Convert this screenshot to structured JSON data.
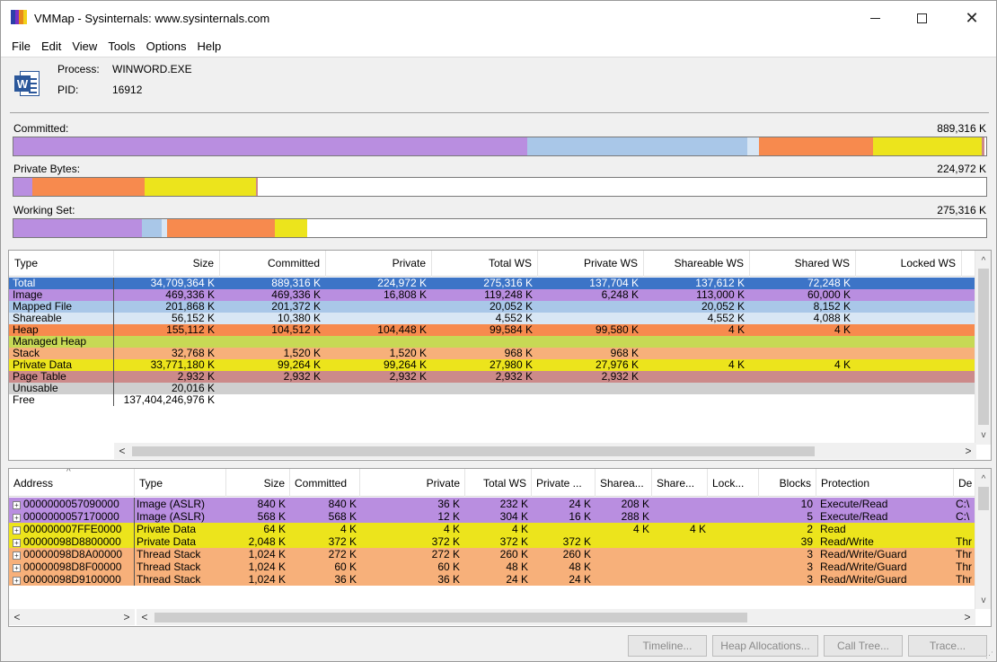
{
  "window": {
    "title": "VMMap - Sysinternals: www.sysinternals.com",
    "icon": "vmmap-app-icon",
    "controls": {
      "minimize": "minimize-icon",
      "maximize": "maximize-icon",
      "close": "close-icon"
    }
  },
  "menu": [
    "File",
    "Edit",
    "View",
    "Tools",
    "Options",
    "Help"
  ],
  "process": {
    "icon": "word-icon",
    "process_label": "Process:",
    "process_value": "WINWORD.EXE",
    "pid_label": "PID:",
    "pid_value": "16912"
  },
  "colors": {
    "image": "#b98ee0",
    "mapped_file": "#a9c7e8",
    "shareable": "#d8e6f4",
    "heap": "#f78a4e",
    "managed_heap": "#c7d955",
    "stack": "#f7b07a",
    "private_data": "#ece41c",
    "page_table": "#cc8a8a",
    "unusable": "#cfcfcf",
    "total_selected": "#3c74c7"
  },
  "bars": {
    "committed": {
      "label": "Committed:",
      "value": "889,316 K",
      "segments": [
        {
          "type": "image",
          "fraction": 0.528
        },
        {
          "type": "mapped_file",
          "fraction": 0.226
        },
        {
          "type": "shareable",
          "fraction": 0.012
        },
        {
          "type": "heap",
          "fraction": 0.118
        },
        {
          "type": "private_data",
          "fraction": 0.111
        },
        {
          "type": "page_table",
          "fraction": 0.003
        }
      ]
    },
    "private_bytes": {
      "label": "Private Bytes:",
      "value": "224,972 K",
      "segments": [
        {
          "type": "image",
          "fraction": 0.019
        },
        {
          "type": "heap",
          "fraction": 0.116
        },
        {
          "type": "private_data",
          "fraction": 0.114
        },
        {
          "type": "page_table",
          "fraction": 0.002
        }
      ]
    },
    "working_set": {
      "label": "Working Set:",
      "value": "275,316 K",
      "segments": [
        {
          "type": "image",
          "fraction": 0.132
        },
        {
          "type": "mapped_file",
          "fraction": 0.02
        },
        {
          "type": "shareable",
          "fraction": 0.006
        },
        {
          "type": "heap",
          "fraction": 0.111
        },
        {
          "type": "private_data",
          "fraction": 0.033
        }
      ]
    }
  },
  "summary": {
    "columns": [
      "Type",
      "Size",
      "Committed",
      "Private",
      "Total WS",
      "Private WS",
      "Shareable WS",
      "Shared WS",
      "Locked WS"
    ],
    "rows": [
      {
        "color": "total_selected",
        "cells": [
          "Total",
          "34,709,364 K",
          "889,316 K",
          "224,972 K",
          "275,316 K",
          "137,704 K",
          "137,612 K",
          "72,248 K",
          ""
        ]
      },
      {
        "color": "image",
        "cells": [
          "Image",
          "469,336 K",
          "469,336 K",
          "16,808 K",
          "119,248 K",
          "6,248 K",
          "113,000 K",
          "60,000 K",
          ""
        ]
      },
      {
        "color": "mapped_file",
        "cells": [
          "Mapped File",
          "201,868 K",
          "201,372 K",
          "",
          "20,052 K",
          "",
          "20,052 K",
          "8,152 K",
          ""
        ]
      },
      {
        "color": "shareable",
        "cells": [
          "Shareable",
          "56,152 K",
          "10,380 K",
          "",
          "4,552 K",
          "",
          "4,552 K",
          "4,088 K",
          ""
        ]
      },
      {
        "color": "heap",
        "cells": [
          "Heap",
          "155,112 K",
          "104,512 K",
          "104,448 K",
          "99,584 K",
          "99,580 K",
          "4 K",
          "4 K",
          ""
        ]
      },
      {
        "color": "managed_heap",
        "cells": [
          "Managed Heap",
          "",
          "",
          "",
          "",
          "",
          "",
          "",
          ""
        ]
      },
      {
        "color": "stack",
        "cells": [
          "Stack",
          "32,768 K",
          "1,520 K",
          "1,520 K",
          "968 K",
          "968 K",
          "",
          "",
          ""
        ]
      },
      {
        "color": "private_data",
        "cells": [
          "Private Data",
          "33,771,180 K",
          "99,264 K",
          "99,264 K",
          "27,980 K",
          "27,976 K",
          "4 K",
          "4 K",
          ""
        ]
      },
      {
        "color": "page_table",
        "cells": [
          "Page Table",
          "2,932 K",
          "2,932 K",
          "2,932 K",
          "2,932 K",
          "2,932 K",
          "",
          "",
          ""
        ]
      },
      {
        "color": "unusable",
        "cells": [
          "Unusable",
          "20,016 K",
          "",
          "",
          "",
          "",
          "",
          "",
          ""
        ]
      },
      {
        "color": "free",
        "cells": [
          "Free",
          "137,404,246,976 K",
          "",
          "",
          "",
          "",
          "",
          "",
          ""
        ]
      }
    ]
  },
  "details": {
    "columns": [
      "Address",
      "Type",
      "Size",
      "Committed",
      "Private",
      "Total WS",
      "Private ...",
      "Sharea...",
      "Share...",
      "Lock...",
      "Blocks",
      "Protection",
      "De"
    ],
    "rows": [
      {
        "color": "image",
        "cells": [
          "0000000057090000",
          "Image (ASLR)",
          "840 K",
          "840 K",
          "36 K",
          "232 K",
          "24 K",
          "208 K",
          "",
          "",
          "10",
          "Execute/Read",
          "C:\\"
        ]
      },
      {
        "color": "image",
        "cells": [
          "0000000057170000",
          "Image (ASLR)",
          "568 K",
          "568 K",
          "12 K",
          "304 K",
          "16 K",
          "288 K",
          "",
          "",
          "5",
          "Execute/Read",
          "C:\\"
        ]
      },
      {
        "color": "private_data",
        "cells": [
          "000000007FFE0000",
          "Private Data",
          "64 K",
          "4 K",
          "4 K",
          "4 K",
          "",
          "4 K",
          "4 K",
          "",
          "2",
          "Read",
          ""
        ]
      },
      {
        "color": "private_data",
        "cells": [
          "00000098D8800000",
          "Private Data",
          "2,048 K",
          "372 K",
          "372 K",
          "372 K",
          "372 K",
          "",
          "",
          "",
          "39",
          "Read/Write",
          "Thr"
        ]
      },
      {
        "color": "stack",
        "cells": [
          "00000098D8A00000",
          "Thread Stack",
          "1,024 K",
          "272 K",
          "272 K",
          "260 K",
          "260 K",
          "",
          "",
          "",
          "3",
          "Read/Write/Guard",
          "Thr"
        ]
      },
      {
        "color": "stack",
        "cells": [
          "00000098D8F00000",
          "Thread Stack",
          "1,024 K",
          "60 K",
          "60 K",
          "48 K",
          "48 K",
          "",
          "",
          "",
          "3",
          "Read/Write/Guard",
          "Thr"
        ]
      },
      {
        "color": "stack",
        "cells": [
          "00000098D9100000",
          "Thread Stack",
          "1,024 K",
          "36 K",
          "36 K",
          "24 K",
          "24 K",
          "",
          "",
          "",
          "3",
          "Read/Write/Guard",
          "Thr"
        ]
      }
    ]
  },
  "buttons": {
    "timeline": "Timeline...",
    "heap_allocations": "Heap Allocations...",
    "call_tree": "Call Tree...",
    "trace": "Trace..."
  },
  "scroll_icons": {
    "up": "^",
    "down": "v",
    "left": "<",
    "right": ">",
    "split_right": ">"
  }
}
